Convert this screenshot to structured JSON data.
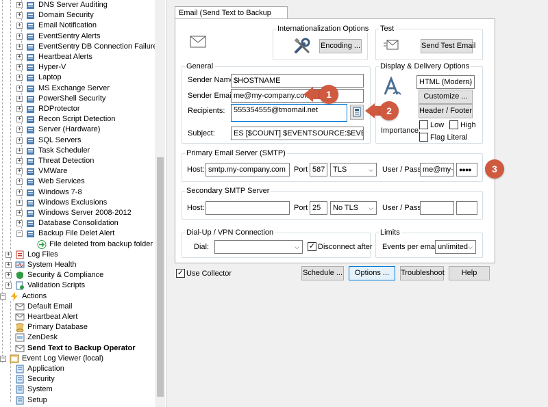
{
  "tree": {
    "items": [
      {
        "label": "DNS Server Auditing"
      },
      {
        "label": "Domain Security"
      },
      {
        "label": "Email Notification"
      },
      {
        "label": "EventSentry Alerts"
      },
      {
        "label": "EventSentry DB Connection Failures"
      },
      {
        "label": "Heartbeat Alerts"
      },
      {
        "label": "Hyper-V"
      },
      {
        "label": "Laptop"
      },
      {
        "label": "MS Exchange Server"
      },
      {
        "label": "PowerShell Security"
      },
      {
        "label": "RDProtector"
      },
      {
        "label": "Recon Script Detection"
      },
      {
        "label": "Server (Hardware)"
      },
      {
        "label": "SQL Servers"
      },
      {
        "label": "Task Scheduler"
      },
      {
        "label": "Threat Detection"
      },
      {
        "label": "VMWare"
      },
      {
        "label": "Web Services"
      },
      {
        "label": "Windows 7-8"
      },
      {
        "label": "Windows Exclusions"
      },
      {
        "label": "Windows Server 2008-2012"
      },
      {
        "label": "Database Consolidation"
      },
      {
        "label": "Backup File Delet Alert"
      },
      {
        "label": "File deleted from backup folder"
      },
      {
        "label": "Log Files"
      },
      {
        "label": "System Health"
      },
      {
        "label": "Security & Compliance"
      },
      {
        "label": "Validation Scripts"
      },
      {
        "label": "Actions"
      },
      {
        "label": "Default Email"
      },
      {
        "label": "Heartbeat Alert"
      },
      {
        "label": "Primary Database"
      },
      {
        "label": "ZenDesk"
      },
      {
        "label": "Send Text to Backup Operator"
      },
      {
        "label": "Event Log Viewer (local)"
      },
      {
        "label": "Application"
      },
      {
        "label": "Security"
      },
      {
        "label": "System"
      },
      {
        "label": "Setup"
      }
    ],
    "expander_collapsed": "+",
    "expander_expanded": "−"
  },
  "tab": {
    "label": "Email (Send Text to Backup Operator)"
  },
  "intl": {
    "title": "Internationalization Options",
    "encoding_button": "Encoding ..."
  },
  "test": {
    "title": "Test",
    "send_test_button": "Send Test Email"
  },
  "general": {
    "title": "General",
    "sender_name_label": "Sender Name:",
    "sender_name_value": "$HOSTNAME",
    "sender_email_label": "Sender Email:",
    "sender_email_value": "me@my-company.com",
    "recipients_label": "Recipients:",
    "recipients_value": "555354555@tmomail.net",
    "subject_label": "Subject:",
    "subject_value": "ES [$COUNT] $EVENTSOURCE:$EVENTCATEGO"
  },
  "display": {
    "title": "Display & Delivery Options",
    "format_value": "HTML (Modern)",
    "customize_button": "Customize ...",
    "header_footer_button": "Header / Footer",
    "importance_label": "Importance:",
    "low_label": "Low",
    "high_label": "High",
    "flag_literal_label": "Flag Literal"
  },
  "primary_smtp": {
    "title": "Primary Email Server (SMTP)",
    "host_label": "Host:",
    "host_value": "smtp.my-company.com",
    "port_label": "Port",
    "port_value": "587",
    "security_value": "TLS",
    "userpass_label": "User / Pass:",
    "user_value": "me@my-cc",
    "pass_value": "●●●●"
  },
  "secondary_smtp": {
    "title": "Secondary SMTP Server",
    "host_label": "Host:",
    "host_value": "",
    "port_label": "Port",
    "port_value": "25",
    "security_value": "No TLS",
    "userpass_label": "User / Pass:"
  },
  "dialup": {
    "title": "Dial-Up / VPN Connection",
    "dial_label": "Dial:",
    "dial_value": "",
    "disconnect_label": "Disconnect after"
  },
  "limits": {
    "title": "Limits",
    "events_label": "Events per email:",
    "events_value": "unlimited"
  },
  "footer": {
    "use_collector_label": "Use Collector",
    "schedule_button": "Schedule ...",
    "options_button": "Options ...",
    "troubleshoot_button": "Troubleshoot",
    "help_button": "Help"
  },
  "callouts": {
    "one": "1",
    "two": "2",
    "three": "3"
  },
  "checkmark": "✓",
  "dropdown_arrow": "⌵",
  "colors": {
    "callout": "#d05a3f",
    "focus": "#0078d7",
    "panel_bg": "#f0f0f0"
  }
}
